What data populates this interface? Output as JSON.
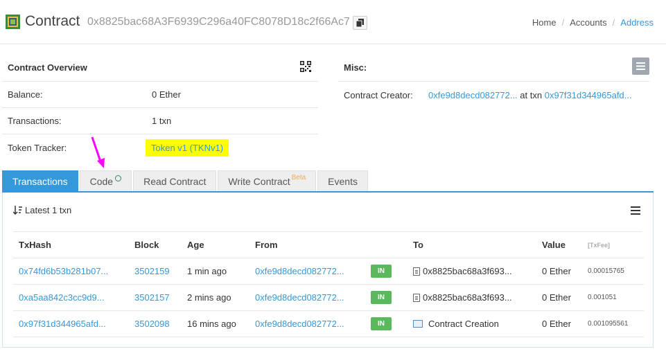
{
  "header": {
    "title": "Contract",
    "address": "0x8825bac68A3F6939C296a40FC8078D18c2f66Ac7",
    "breadcrumb": [
      "Home",
      "Accounts",
      "Address"
    ]
  },
  "overview": {
    "title": "Contract Overview",
    "rows": [
      {
        "label": "Balance:",
        "value": "0 Ether"
      },
      {
        "label": "Transactions:",
        "value": "1 txn"
      },
      {
        "label": "Token Tracker:",
        "value": "Token v1 (TKNv1)"
      }
    ]
  },
  "misc": {
    "title": "Misc:",
    "creator_label": "Contract Creator:",
    "creator_address": "0xfe9d8decd082772...",
    "at_txn": "at txn",
    "creator_txn": "0x97f31d344965afd..."
  },
  "tabs": [
    {
      "label": "Transactions"
    },
    {
      "label": "Code"
    },
    {
      "label": "Read Contract"
    },
    {
      "label": "Write Contract",
      "badge": "Beta"
    },
    {
      "label": "Events"
    }
  ],
  "panel": {
    "latest": "Latest 1 txn",
    "columns": [
      "TxHash",
      "Block",
      "Age",
      "From",
      "",
      "To",
      "Value",
      "[TxFee]"
    ],
    "rows": [
      {
        "hash": "0x74fd6b53b281b07...",
        "block": "3502159",
        "age": "1 min ago",
        "from": "0xfe9d8decd082772...",
        "dir": "IN",
        "to": "0x8825bac68a3f693...",
        "value": "0 Ether",
        "fee": "0.00015765"
      },
      {
        "hash": "0xa5aa842c3cc9d9...",
        "block": "3502157",
        "age": "2 mins ago",
        "from": "0xfe9d8decd082772...",
        "dir": "IN",
        "to": "0x8825bac68a3f693...",
        "value": "0 Ether",
        "fee": "0.001051"
      },
      {
        "hash": "0x97f31d344965afd...",
        "block": "3502098",
        "age": "16 mins ago",
        "from": "0xfe9d8decd082772...",
        "dir": "IN",
        "to": "Contract Creation",
        "value": "0 Ether",
        "fee": "0.001095561"
      }
    ]
  },
  "colors": {
    "accent": "#3498db",
    "in_badge": "#5cb85c",
    "highlight": "#ffff00",
    "arrow": "#ff00ff"
  }
}
